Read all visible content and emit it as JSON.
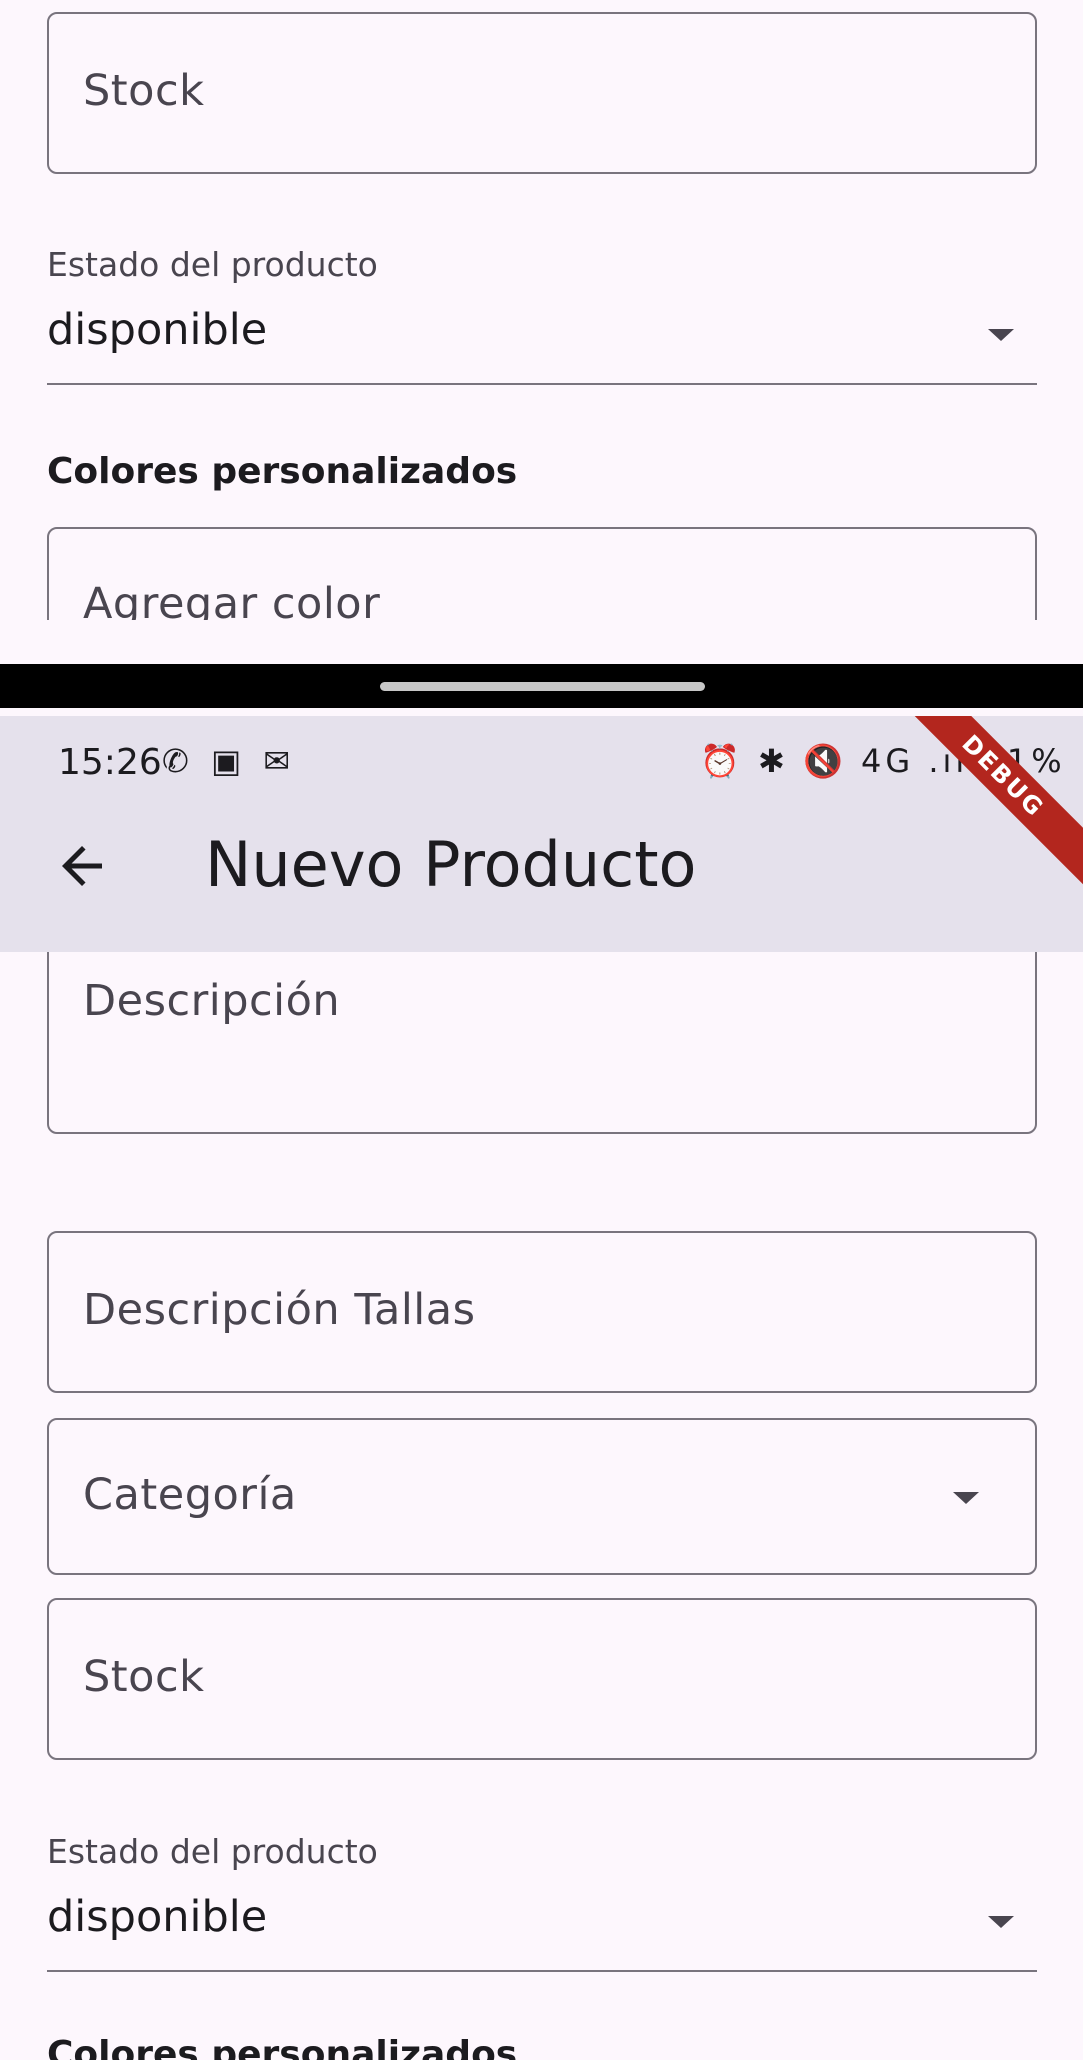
{
  "top_section": {
    "stock_placeholder": "Stock",
    "estado_label": "Estado del producto",
    "estado_value": "disponible",
    "colores_title": "Colores personalizados",
    "agregar_color_placeholder": "Agregar color"
  },
  "status_bar": {
    "time": "15:26",
    "left_icons": "✆ ▣ ✉",
    "right_icons": "⏰ ✱ 🔇 4G .ıl",
    "battery": "21%"
  },
  "app_bar": {
    "title": "Nuevo Producto",
    "back_icon": "arrow-back-icon",
    "debug_banner": "DEBUG"
  },
  "form": {
    "descripcion_placeholder": "Descripción",
    "descripcion_tallas_placeholder": "Descripción Tallas",
    "categoria_placeholder": "Categoría",
    "stock_placeholder": "Stock",
    "estado_label": "Estado del producto",
    "estado_value": "disponible",
    "colores_title": "Colores personalizados"
  }
}
